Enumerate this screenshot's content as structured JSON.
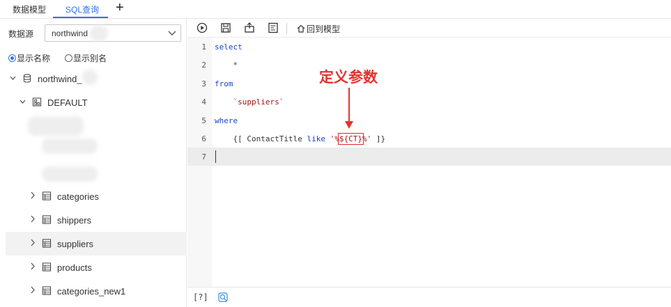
{
  "tabs": [
    {
      "label": "数据模型"
    },
    {
      "label": "SQL查询"
    }
  ],
  "left": {
    "datasource_label": "数据源",
    "datasource_value": "northwind",
    "radio_name": "显示名称",
    "radio_alias": "显示别名",
    "db_name": "northwind_",
    "schema_name": "DEFAULT",
    "tables": [
      "categories",
      "shippers",
      "suppliers",
      "products",
      "categories_new1"
    ]
  },
  "toolbar": {
    "back_label": "回到模型"
  },
  "editor": {
    "lines": [
      {
        "num": "1",
        "text": "select"
      },
      {
        "num": "2",
        "text": "    *"
      },
      {
        "num": "3",
        "text": "from"
      },
      {
        "num": "4",
        "text": "    `suppliers`"
      },
      {
        "num": "5",
        "text": "where"
      },
      {
        "num": "6",
        "pre": "    {[ ContactTitle ",
        "kw": "like",
        "mid": " '%",
        "param": "${CT}",
        "post": "%'",
        "end": " ]}"
      },
      {
        "num": "7",
        "text": ""
      }
    ]
  },
  "annotation": "定义参数",
  "footer": {
    "help": "[?]"
  },
  "colors": {
    "accent": "#2e74e8",
    "keyword": "#1a44c8",
    "string": "#a31515",
    "annotation": "#e33330"
  }
}
